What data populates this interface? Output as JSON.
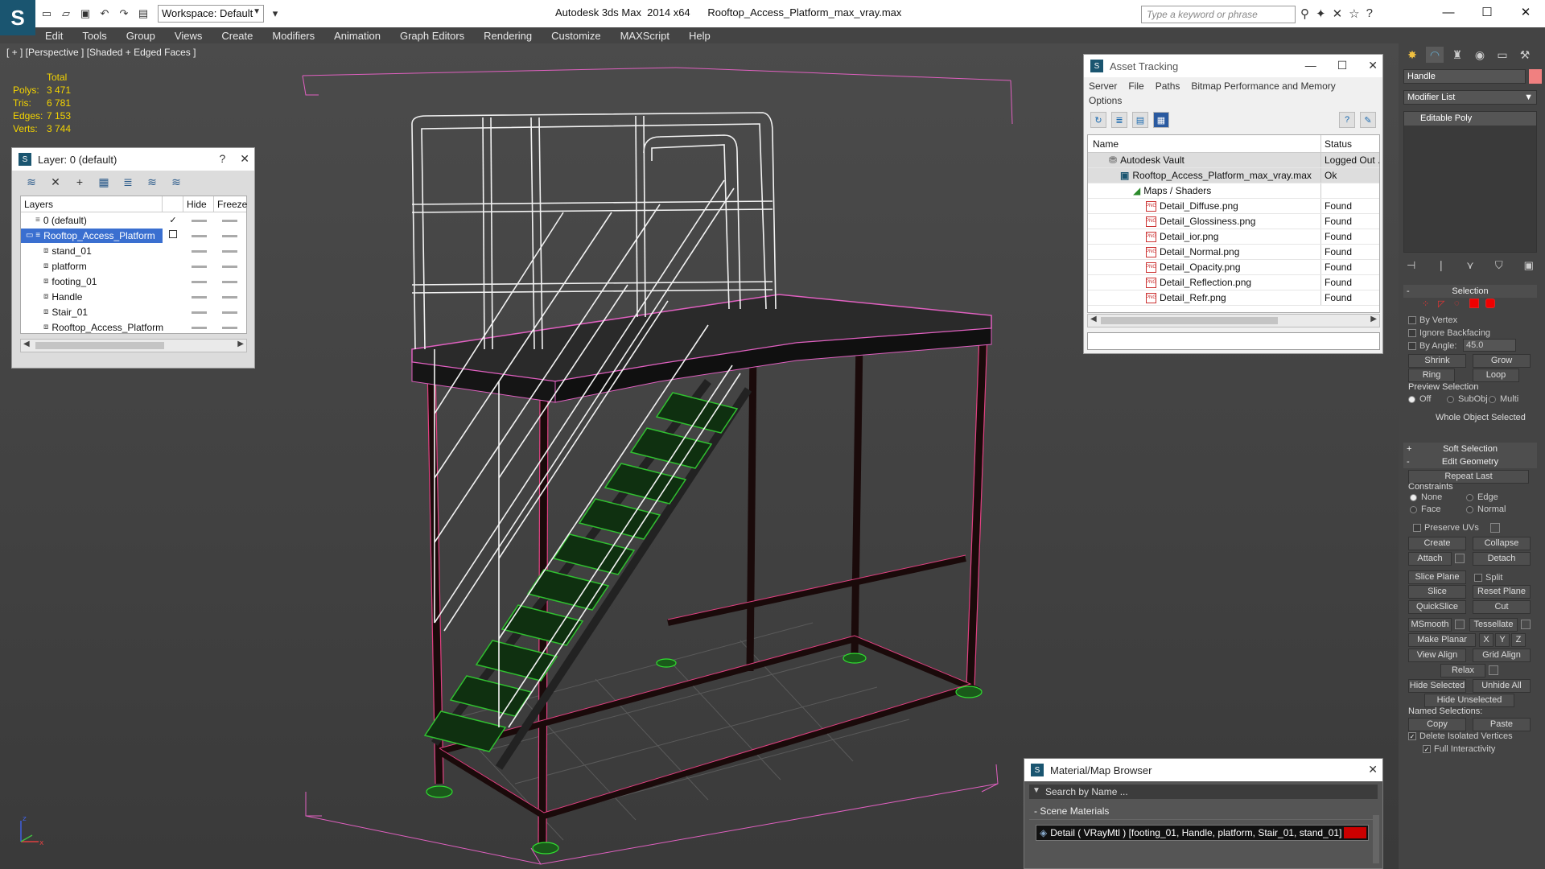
{
  "titlebar": {
    "logo_text": "S",
    "workspace": "Workspace: Default",
    "title": "Autodesk 3ds Max  2014 x64      Rooftop_Access_Platform_max_vray.max",
    "search_placeholder": "Type a keyword or phrase"
  },
  "menu": [
    "Edit",
    "Tools",
    "Group",
    "Views",
    "Create",
    "Modifiers",
    "Animation",
    "Graph Editors",
    "Rendering",
    "Customize",
    "MAXScript",
    "Help"
  ],
  "viewport": {
    "label": "[ + ] [Perspective ] [Shaded + Edged Faces ]",
    "stats": {
      "total": "Total",
      "rows": [
        {
          "label": "Polys:",
          "value": "3 471"
        },
        {
          "label": "Tris:",
          "value": "6 781"
        },
        {
          "label": "Edges:",
          "value": "7 153"
        },
        {
          "label": "Verts:",
          "value": "3 744"
        }
      ]
    },
    "axis": {
      "z": "z",
      "x": "x"
    }
  },
  "layer_panel": {
    "title": "Layer: 0 (default)",
    "help": "?",
    "close": "✕",
    "columns": {
      "layers": "Layers",
      "hide": "Hide",
      "freeze": "Freeze"
    },
    "rows": [
      {
        "name": "0 (default)",
        "check": "✓"
      },
      {
        "name": "Rooftop_Access_Platform",
        "check": ""
      },
      {
        "name": "stand_01"
      },
      {
        "name": "platform"
      },
      {
        "name": "footing_01"
      },
      {
        "name": "Handle"
      },
      {
        "name": "Stair_01"
      },
      {
        "name": "Rooftop_Access_Platform"
      }
    ]
  },
  "asset_panel": {
    "title": "Asset Tracking",
    "menu": [
      "Server",
      "File",
      "Paths",
      "Bitmap Performance and Memory",
      "Options"
    ],
    "columns": {
      "name": "Name",
      "status": "Status"
    },
    "rows": [
      {
        "name": "Autodesk Vault",
        "status": "Logged Out ..."
      },
      {
        "name": "Rooftop_Access_Platform_max_vray.max",
        "status": "Ok"
      },
      {
        "name": "Maps / Shaders",
        "status": ""
      },
      {
        "name": "Detail_Diffuse.png",
        "status": "Found"
      },
      {
        "name": "Detail_Glossiness.png",
        "status": "Found"
      },
      {
        "name": "Detail_ior.png",
        "status": "Found"
      },
      {
        "name": "Detail_Normal.png",
        "status": "Found"
      },
      {
        "name": "Detail_Opacity.png",
        "status": "Found"
      },
      {
        "name": "Detail_Reflection.png",
        "status": "Found"
      },
      {
        "name": "Detail_Refr.png",
        "status": "Found"
      }
    ]
  },
  "material_browser": {
    "title": "Material/Map Browser",
    "search_placeholder": "Search by Name ...",
    "section": "- Scene Materials",
    "item": "Detail  ( VRayMtl )  [footing_01, Handle, platform, Stair_01, stand_01]"
  },
  "command_panel": {
    "object_name": "Handle",
    "object_color": "#f08080",
    "modifier_list": "Modifier List",
    "stack_item": "Editable Poly",
    "selection": {
      "head": "Selection",
      "by_vertex": "By Vertex",
      "ignore_backfacing": "Ignore Backfacing",
      "by_angle": "By Angle:",
      "angle_value": "45.0",
      "shrink": "Shrink",
      "grow": "Grow",
      "ring": "Ring",
      "loop": "Loop",
      "preview_selection": "Preview Selection",
      "off": "Off",
      "subobj": "SubObj",
      "multi": "Multi",
      "whole_object": "Whole Object Selected"
    },
    "soft_selection": "Soft Selection",
    "edit_geometry": {
      "head": "Edit Geometry",
      "repeat_last": "Repeat Last",
      "constraints": "Constraints",
      "none": "None",
      "edge": "Edge",
      "face": "Face",
      "normal": "Normal",
      "preserve_uvs": "Preserve UVs",
      "create": "Create",
      "collapse": "Collapse",
      "attach": "Attach",
      "detach": "Detach",
      "slice_plane": "Slice Plane",
      "split": "Split",
      "slice": "Slice",
      "reset_plane": "Reset Plane",
      "quickslice": "QuickSlice",
      "cut": "Cut",
      "msmooth": "MSmooth",
      "tessellate": "Tessellate",
      "make_planar": "Make Planar",
      "x": "X",
      "y": "Y",
      "z": "Z",
      "view_align": "View Align",
      "grid_align": "Grid Align",
      "relax": "Relax",
      "hide_selected": "Hide Selected",
      "unhide_all": "Unhide All",
      "hide_unselected": "Hide Unselected",
      "named_selections": "Named Selections:",
      "copy": "Copy",
      "paste": "Paste",
      "delete_isolated": "Delete Isolated Vertices",
      "full_interactivity": "Full Interactivity"
    }
  },
  "colors": {
    "accent": "#1a5570",
    "selection": "#3a6fd0",
    "wire_pink": "#e060c0",
    "wire_green": "#30c030",
    "stat_yellow": "#f4d400"
  }
}
